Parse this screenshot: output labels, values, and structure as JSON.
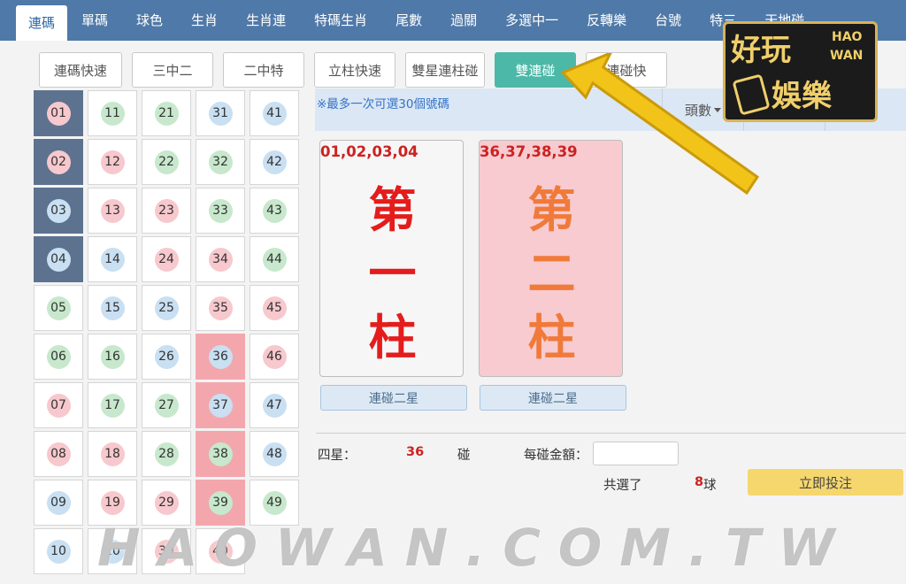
{
  "nav": {
    "items": [
      {
        "label": "連碼",
        "active": true
      },
      {
        "label": "單碼"
      },
      {
        "label": "球色"
      },
      {
        "label": "生肖"
      },
      {
        "label": "生肖連"
      },
      {
        "label": "特碼生肖"
      },
      {
        "label": "尾數"
      },
      {
        "label": "過關"
      },
      {
        "label": "多選中一"
      },
      {
        "label": "反轉樂"
      },
      {
        "label": "台號"
      },
      {
        "label": "特三"
      },
      {
        "label": "天地碰"
      }
    ]
  },
  "subtabs": [
    {
      "label": "連碼快速"
    },
    {
      "label": "三中二"
    },
    {
      "label": "二中特"
    },
    {
      "label": "立柱快速"
    },
    {
      "label": "雙星連柱碰"
    },
    {
      "label": "雙連碰",
      "active": true
    },
    {
      "label": "連碰快"
    }
  ],
  "numbers": {
    "color_key": {
      "red": "#f7c8cd",
      "green": "#c7e8cc",
      "blue": "#c9dff2"
    },
    "selected_first": [
      "01",
      "02",
      "03",
      "04"
    ],
    "selected_second": [
      "36",
      "37",
      "38",
      "39"
    ],
    "balls": [
      {
        "n": "01",
        "c": "red"
      },
      {
        "n": "11",
        "c": "green"
      },
      {
        "n": "21",
        "c": "green"
      },
      {
        "n": "31",
        "c": "blue"
      },
      {
        "n": "41",
        "c": "blue"
      },
      {
        "n": "02",
        "c": "red"
      },
      {
        "n": "12",
        "c": "red"
      },
      {
        "n": "22",
        "c": "green"
      },
      {
        "n": "32",
        "c": "green"
      },
      {
        "n": "42",
        "c": "blue"
      },
      {
        "n": "03",
        "c": "blue"
      },
      {
        "n": "13",
        "c": "red"
      },
      {
        "n": "23",
        "c": "red"
      },
      {
        "n": "33",
        "c": "green"
      },
      {
        "n": "43",
        "c": "green"
      },
      {
        "n": "04",
        "c": "blue"
      },
      {
        "n": "14",
        "c": "blue"
      },
      {
        "n": "24",
        "c": "red"
      },
      {
        "n": "34",
        "c": "red"
      },
      {
        "n": "44",
        "c": "green"
      },
      {
        "n": "05",
        "c": "green"
      },
      {
        "n": "15",
        "c": "blue"
      },
      {
        "n": "25",
        "c": "blue"
      },
      {
        "n": "35",
        "c": "red"
      },
      {
        "n": "45",
        "c": "red"
      },
      {
        "n": "06",
        "c": "green"
      },
      {
        "n": "16",
        "c": "green"
      },
      {
        "n": "26",
        "c": "blue"
      },
      {
        "n": "36",
        "c": "blue"
      },
      {
        "n": "46",
        "c": "red"
      },
      {
        "n": "07",
        "c": "red"
      },
      {
        "n": "17",
        "c": "green"
      },
      {
        "n": "27",
        "c": "green"
      },
      {
        "n": "37",
        "c": "blue"
      },
      {
        "n": "47",
        "c": "blue"
      },
      {
        "n": "08",
        "c": "red"
      },
      {
        "n": "18",
        "c": "red"
      },
      {
        "n": "28",
        "c": "green"
      },
      {
        "n": "38",
        "c": "green"
      },
      {
        "n": "48",
        "c": "blue"
      },
      {
        "n": "09",
        "c": "blue"
      },
      {
        "n": "19",
        "c": "red"
      },
      {
        "n": "29",
        "c": "red"
      },
      {
        "n": "39",
        "c": "green"
      },
      {
        "n": "49",
        "c": "green"
      },
      {
        "n": "10",
        "c": "blue"
      },
      {
        "n": "20",
        "c": "blue"
      },
      {
        "n": "30",
        "c": "red"
      },
      {
        "n": "40",
        "c": "red"
      }
    ]
  },
  "info": {
    "hint": "※最多一次可選30個號碼",
    "head_label": "頭數"
  },
  "columns": [
    {
      "numbers": "01,02,03,04",
      "title": [
        "第",
        "一",
        "柱"
      ],
      "button": "連碰二星"
    },
    {
      "numbers": "36,37,38,39",
      "title": [
        "第",
        "二",
        "柱"
      ],
      "button": "連碰二星"
    }
  ],
  "summary": {
    "group_label": "四星：",
    "count": "36",
    "count_unit": "碰",
    "amount_label": "每碰金額：",
    "amount_value": "",
    "total_label": "共選了",
    "total_count": "8",
    "total_unit": "球",
    "submit_label": "立即投注"
  },
  "logo": {
    "cn1": "好玩",
    "cn2": "娛樂",
    "en1": "HAO",
    "en2": "WAN"
  },
  "watermark": "HAOWAN.COM.TW",
  "colors": {
    "nav_bg": "#4f79a8",
    "active_tab": "#4cb8a8",
    "submit": "#f5d76e",
    "arrow": "#f2c318"
  }
}
